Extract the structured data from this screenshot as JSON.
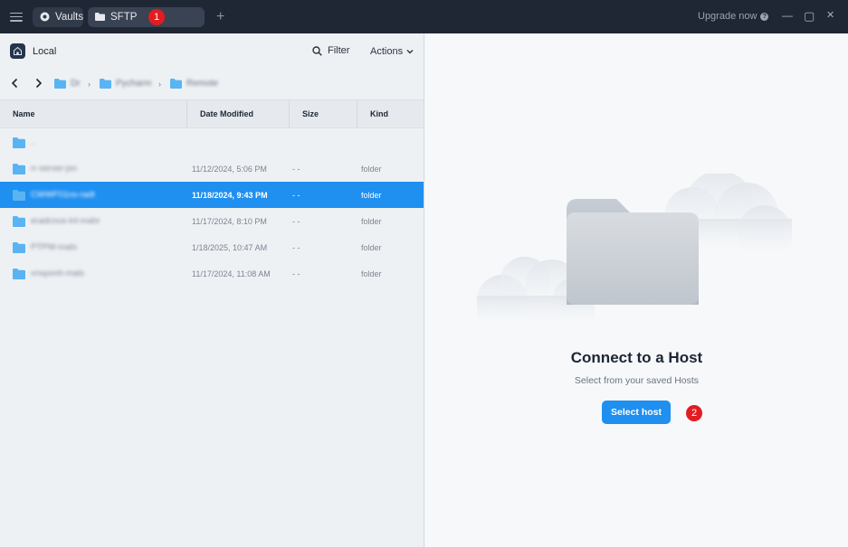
{
  "titlebar": {
    "tabs": [
      {
        "label": "Vaults"
      },
      {
        "label": "SFTP"
      }
    ],
    "badge1": "1",
    "upgrade_label": "Upgrade now",
    "new_tab": "+",
    "controls": {
      "minimize": "—",
      "maximize": "▢",
      "close": "✕"
    }
  },
  "left": {
    "location_label": "Local",
    "filter_label": "Filter",
    "actions_label": "Actions",
    "breadcrumbs": [
      "Dr",
      "Pycharm",
      "Remote"
    ],
    "columns": [
      "Name",
      "Date Modified",
      "Size",
      "Kind"
    ],
    "rows": [
      {
        "name": "..",
        "date": "",
        "size": "",
        "kind": ""
      },
      {
        "name": "rr-server-jsn",
        "date": "11/12/2024, 5:06 PM",
        "size": "- -",
        "kind": "folder"
      },
      {
        "name": "CWWF01ns-radt",
        "date": "11/18/2024, 9:43 PM",
        "size": "- -",
        "kind": "folder"
      },
      {
        "name": "eradcnce-lnl-mahr",
        "date": "11/17/2024, 8:10 PM",
        "size": "- -",
        "kind": "folder"
      },
      {
        "name": "PTPW-mats",
        "date": "1/18/2025, 10:47 AM",
        "size": "- -",
        "kind": "folder"
      },
      {
        "name": "vnsponh-mals",
        "date": "11/17/2024, 11:08 AM",
        "size": "- -",
        "kind": "folder"
      }
    ],
    "selected_row": 2
  },
  "right": {
    "heading": "Connect to a Host",
    "subtext": "Select from your saved Hosts",
    "button_label": "Select host",
    "badge2": "2"
  },
  "colors": {
    "titlebar_bg": "#1f2735",
    "accent": "#1f8ff0",
    "badge": "#e11d21",
    "folder": "#5ab4f2"
  }
}
